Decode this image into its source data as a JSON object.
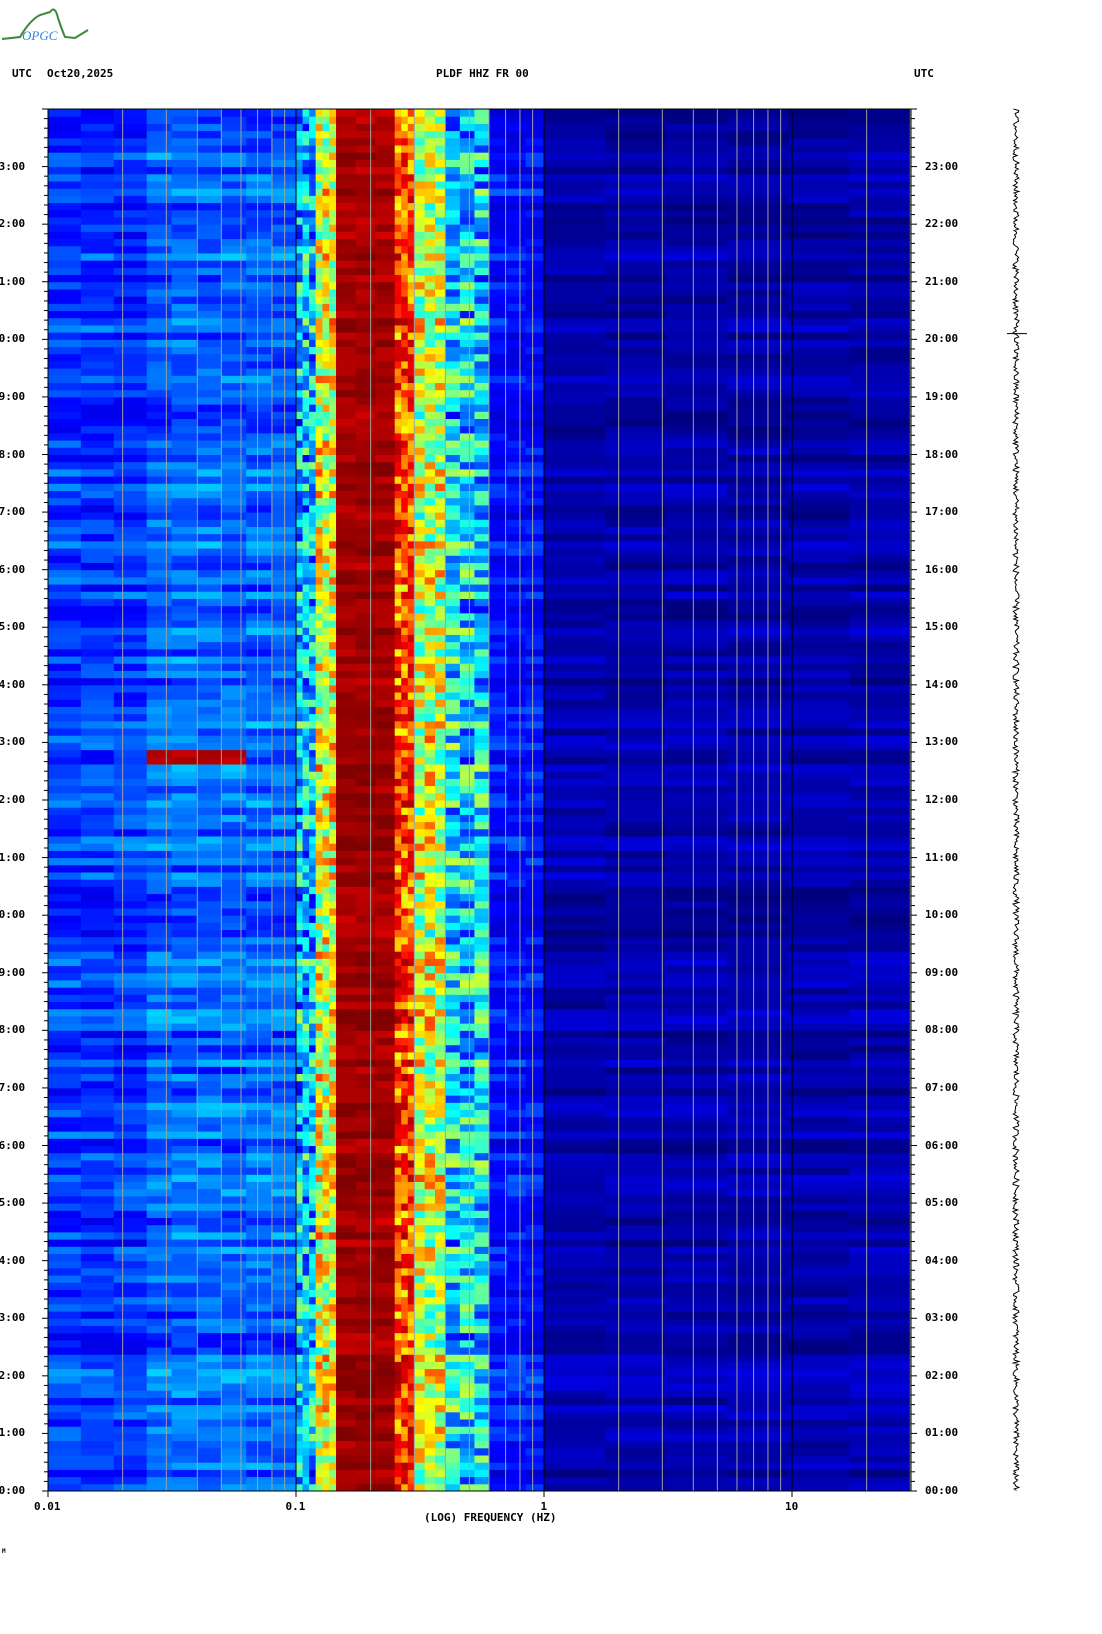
{
  "header": {
    "left_tz": "UTC",
    "date": "Oct20,2025",
    "station": "PLDF HHZ FR 00",
    "right_tz": "UTC"
  },
  "logo": {
    "text": "OPGC"
  },
  "footer_mark": "M",
  "chart_data": {
    "type": "heatmap",
    "title": "PLDF HHZ FR 00",
    "xlabel": "(LOG) FREQUENCY (HZ)",
    "ylabel": "UTC",
    "xscale": "log",
    "xlim": [
      0.01,
      30
    ],
    "ylim_hours": [
      0,
      24
    ],
    "x_ticks": [
      {
        "value": 0.01,
        "label": "0.01"
      },
      {
        "value": 0.1,
        "label": "0.1"
      },
      {
        "value": 1,
        "label": "1"
      },
      {
        "value": 10,
        "label": "10"
      }
    ],
    "y_ticks": [
      "00:00",
      "01:00",
      "02:00",
      "03:00",
      "04:00",
      "05:00",
      "06:00",
      "07:00",
      "08:00",
      "09:00",
      "10:00",
      "11:00",
      "12:00",
      "13:00",
      "14:00",
      "15:00",
      "16:00",
      "17:00",
      "18:00",
      "19:00",
      "20:00",
      "21:00",
      "22:00",
      "23:00"
    ],
    "colormap": [
      "#00007f",
      "#0000ff",
      "#00ffff",
      "#ffff00",
      "#ff0000",
      "#7f0000"
    ],
    "bands": [
      {
        "f_min": 0.01,
        "f_max": 0.025,
        "level": 0.24
      },
      {
        "f_min": 0.025,
        "f_max": 0.1,
        "level": 0.28
      },
      {
        "f_min": 0.1,
        "f_max": 0.12,
        "level": 0.36
      },
      {
        "f_min": 0.12,
        "f_max": 0.145,
        "level": 0.58
      },
      {
        "f_min": 0.145,
        "f_max": 0.25,
        "level": 0.95
      },
      {
        "f_min": 0.25,
        "f_max": 0.3,
        "level": 0.76
      },
      {
        "f_min": 0.3,
        "f_max": 0.4,
        "level": 0.56
      },
      {
        "f_min": 0.4,
        "f_max": 0.6,
        "level": 0.38
      },
      {
        "f_min": 0.6,
        "f_max": 1.0,
        "level": 0.2
      },
      {
        "f_min": 1.0,
        "f_max": 30,
        "level": 0.07
      }
    ],
    "events": [
      {
        "start_hour": 12.6,
        "end_hour": 12.9,
        "f_min": 0.025,
        "f_max": 0.07,
        "level": 0.92
      }
    ]
  }
}
